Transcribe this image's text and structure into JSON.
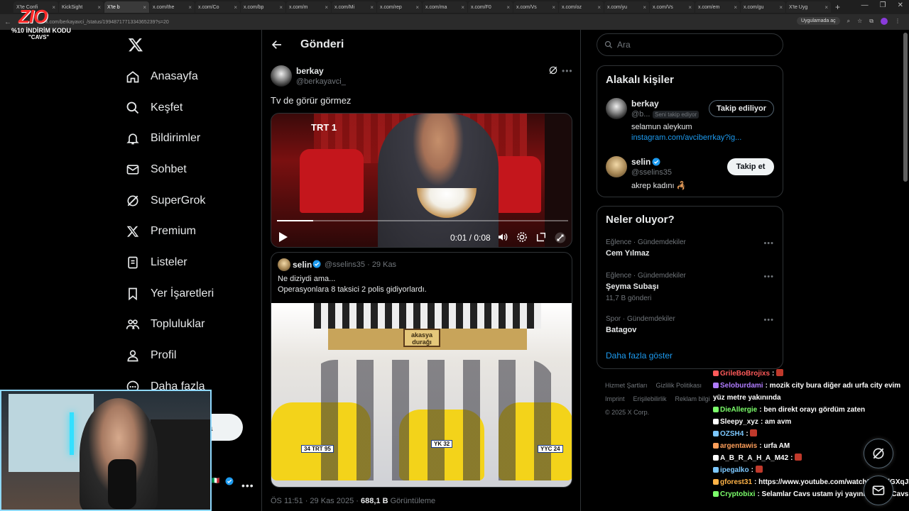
{
  "browser": {
    "tabs": [
      {
        "label": "X'te Confi",
        "active": false
      },
      {
        "label": "KickSight",
        "active": false
      },
      {
        "label": "X'te b",
        "active": true
      },
      {
        "label": "x.com/the",
        "active": false
      },
      {
        "label": "x.com/Co",
        "active": false
      },
      {
        "label": "x.com/bp",
        "active": false
      },
      {
        "label": "x.com/m",
        "active": false
      },
      {
        "label": "x.com/Mi",
        "active": false
      },
      {
        "label": "x.com/rep",
        "active": false
      },
      {
        "label": "x.com/ma",
        "active": false
      },
      {
        "label": "x.com/F0",
        "active": false
      },
      {
        "label": "x.com/Vs",
        "active": false
      },
      {
        "label": "x.com/oz",
        "active": false
      },
      {
        "label": "x.com/yu",
        "active": false
      },
      {
        "label": "x.com/Vs",
        "active": false
      },
      {
        "label": "x.com/em",
        "active": false
      },
      {
        "label": "x.com/gu",
        "active": false
      },
      {
        "label": "X'te Uyg",
        "active": false
      }
    ],
    "url": "x.com/berkayavci_/status/1994871771334365239?s=20",
    "open_app_label": "Uygulamada aç"
  },
  "stream_logo": {
    "brand": "ZIO",
    "promo_line1": "%10 İNDİRİM KODU",
    "promo_line2": "\"CAVS\""
  },
  "sidebar": {
    "items": [
      {
        "label": "Anasayfa",
        "icon": "home-icon"
      },
      {
        "label": "Keşfet",
        "icon": "search-icon"
      },
      {
        "label": "Bildirimler",
        "icon": "bell-icon"
      },
      {
        "label": "Sohbet",
        "icon": "mail-icon"
      },
      {
        "label": "SuperGrok",
        "icon": "grok-icon"
      },
      {
        "label": "Premium",
        "icon": "x-icon"
      },
      {
        "label": "Listeler",
        "icon": "list-icon"
      },
      {
        "label": "Yer İşaretleri",
        "icon": "bookmark-icon"
      },
      {
        "label": "Topluluklar",
        "icon": "people-icon"
      },
      {
        "label": "Profil",
        "icon": "person-icon"
      },
      {
        "label": "Daha fazla",
        "icon": "more-circle-icon"
      }
    ],
    "post_button_partial": "a"
  },
  "post": {
    "header_title": "Gönderi",
    "author_name": "berkay",
    "author_handle": "@berkayavci_",
    "text": "Tv de görür görmez",
    "video": {
      "channel_logo": "TRT 1",
      "time": "0:01 / 0:08",
      "progress": 0.125
    },
    "quote": {
      "author_name": "selin",
      "author_handle": "@sselins35",
      "date": "· 29 Kas",
      "text_line1": "Ne diziydi ama...",
      "text_line2": "Operasyonlara 8 taksici 2 polis gidiyorlardı.",
      "image_sign": "akasya durağı",
      "plates": [
        "34 TRT 95",
        "YK 32",
        "YYC 24"
      ]
    },
    "meta": {
      "time_date": "ÖS 11:51 · 29 Kas 2025 · ",
      "views_value": "688,1 B",
      "views_label": " Görüntüleme"
    }
  },
  "right": {
    "search_placeholder": "Ara",
    "related": {
      "title": "Alakalı kişiler",
      "people": [
        {
          "name": "berkay",
          "handle": "@b...",
          "follows_you": "Seni takip ediyor",
          "bio": "selamun aleykum",
          "link": "instagram.com/avciberrkay?ig...",
          "button": "Takip ediliyor"
        },
        {
          "name": "selin",
          "handle": "@sselins35",
          "bio": "akrep kadını 🦂",
          "button": "Takip et"
        }
      ]
    },
    "trends": {
      "title": "Neler oluyor?",
      "items": [
        {
          "context": "Eğlence · Gündemdekiler",
          "name": "Cem Yılmaz",
          "count": ""
        },
        {
          "context": "Eğlence · Gündemdekiler",
          "name": "Şeyma Subaşı",
          "count": "11,7 B gönderi"
        },
        {
          "context": "Spor · Gündemdekiler",
          "name": "Batagov",
          "count": ""
        }
      ],
      "show_more": "Daha fazla göster"
    },
    "footer": {
      "links": [
        "Hizmet Şartları",
        "Gizlilik Politikası",
        "Imprint",
        "Erişilebilirlik",
        "Reklam bilgi"
      ],
      "copyright": "© 2025 X Corp."
    }
  },
  "chat": [
    {
      "user": "GrileBoBrojixs",
      "color": "#ff5a5a",
      "msg": ":",
      "emote": true
    },
    {
      "user": "Seloburdami",
      "color": "#b07cff",
      "msg": ": mozik city bura diğer adı urfa city evim yüz metre yakınında",
      "emote": false,
      "wrap": true
    },
    {
      "user": "DieAllergie",
      "color": "#7cff6b",
      "msg": ": ben direkt orayı gördüm zaten",
      "emote": false
    },
    {
      "user": "Sleepy_xyz",
      "color": "#ffffff",
      "msg": ": am avm",
      "emote": false
    },
    {
      "user": "OZSH4",
      "color": "#7cc8ff",
      "msg": ":",
      "emote": true
    },
    {
      "user": "argentawis",
      "color": "#ff9f5a",
      "msg": ": urfa AM",
      "emote": false
    },
    {
      "user": "A_B_R_A_H_A_M42",
      "color": "#ffffff",
      "msg": ":",
      "emote": true
    },
    {
      "user": "ipegalko",
      "color": "#7cc8ff",
      "msg": ":",
      "emote": true
    },
    {
      "user": "gforest31",
      "color": "#ffb347",
      "msg": ": https://www.youtube.com/watch?v=uqlGXqJHnGk",
      "emote": false
    },
    {
      "user": "Cryptobixi",
      "color": "#7cff6b",
      "msg": ": Selamlar Cavs ustam iyi yayınlar 💚 @Cavs",
      "emote": false
    }
  ]
}
